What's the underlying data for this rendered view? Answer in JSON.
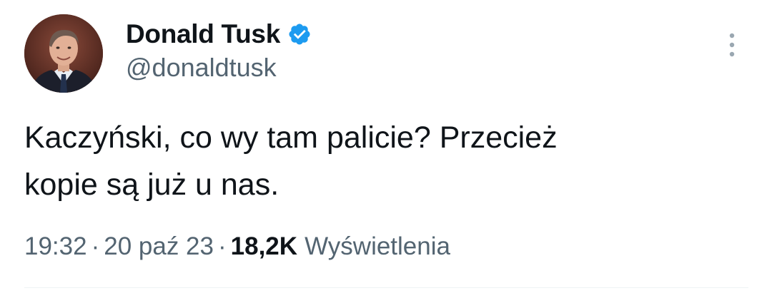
{
  "author": {
    "display_name": "Donald Tusk",
    "handle": "@donaldtusk",
    "verified": true,
    "verified_icon": "verified-badge-icon",
    "avatar_icon": "profile-avatar"
  },
  "tweet": {
    "text_lines": [
      "Kaczyński, co wy tam palicie? Przecież",
      "kopie są już u nas."
    ],
    "time": "19:32",
    "separator": "·",
    "date": "20 paź 23",
    "views_count": "18,2K",
    "views_label": "Wyświetlenia"
  },
  "menu": {
    "icon": "more-options-icon"
  },
  "colors": {
    "text_primary": "#0f1419",
    "text_secondary": "#536471",
    "verified_blue": "#1d9bf0",
    "divider": "#eff3f4"
  }
}
